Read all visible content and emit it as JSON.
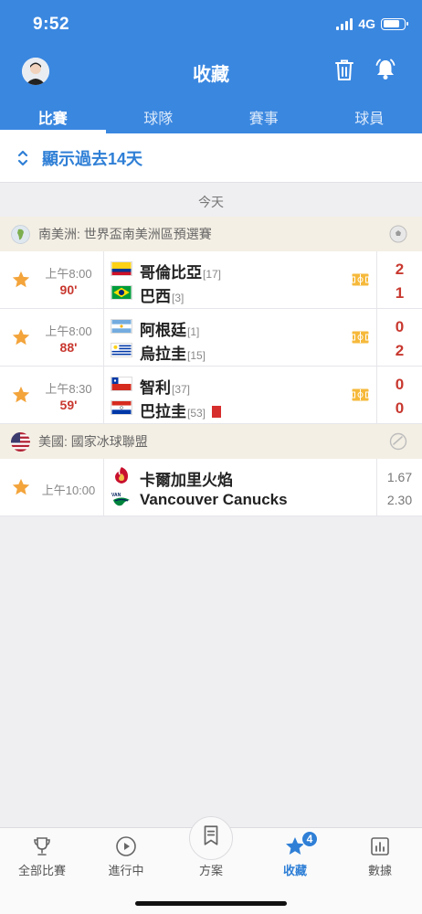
{
  "status_bar": {
    "time": "9:52",
    "network": "4G"
  },
  "header": {
    "title": "收藏"
  },
  "tabs": [
    {
      "label": "比賽",
      "active": true
    },
    {
      "label": "球隊",
      "active": false
    },
    {
      "label": "賽事",
      "active": false
    },
    {
      "label": "球員",
      "active": false
    }
  ],
  "show_past": {
    "label": "顯示過去14天"
  },
  "day_label": "今天",
  "leagues": [
    {
      "name": "南美洲: 世界盃南美洲區預選賽",
      "matches": [
        {
          "favorited": true,
          "time": "上午8:00",
          "minute": "90'",
          "home": {
            "name": "哥倫比亞",
            "rank": "[17]",
            "flag": "colombia-flag"
          },
          "away": {
            "name": "巴西",
            "rank": "[3]",
            "flag": "brazil-flag"
          },
          "home_score": "2",
          "away_score": "1"
        },
        {
          "favorited": true,
          "time": "上午8:00",
          "minute": "88'",
          "home": {
            "name": "阿根廷",
            "rank": "[1]",
            "flag": "argentina-flag"
          },
          "away": {
            "name": "烏拉圭",
            "rank": "[15]",
            "flag": "uruguay-flag"
          },
          "home_score": "0",
          "away_score": "2"
        },
        {
          "favorited": true,
          "time": "上午8:30",
          "minute": "59'",
          "home": {
            "name": "智利",
            "rank": "[37]",
            "flag": "chile-flag"
          },
          "away": {
            "name": "巴拉圭",
            "rank": "[53]",
            "flag": "paraguay-flag",
            "red_cards": 1
          },
          "home_score": "0",
          "away_score": "0"
        }
      ]
    },
    {
      "name": "美國: 國家冰球聯盟",
      "matches": [
        {
          "favorited": true,
          "time": "上午10:00",
          "home": {
            "name": "卡爾加里火焰",
            "logo": "calgary-flames-logo"
          },
          "away": {
            "name": "Vancouver Canucks",
            "logo": "vancouver-canucks-logo"
          },
          "home_odds": "1.67",
          "away_odds": "2.30"
        }
      ]
    }
  ],
  "bottom_nav": [
    {
      "label": "全部比賽",
      "icon": "trophy-icon",
      "active": false
    },
    {
      "label": "進行中",
      "icon": "play-icon",
      "active": false
    },
    {
      "label": "方案",
      "icon": "bookmark-icon",
      "active": false
    },
    {
      "label": "收藏",
      "icon": "star-icon",
      "active": true,
      "badge": "4"
    },
    {
      "label": "數據",
      "icon": "stats-icon",
      "active": false
    }
  ],
  "colors": {
    "primary": "#3a87e0",
    "live": "#c8382f",
    "star": "#f3a43b",
    "league_bg": "#f4efe4"
  }
}
